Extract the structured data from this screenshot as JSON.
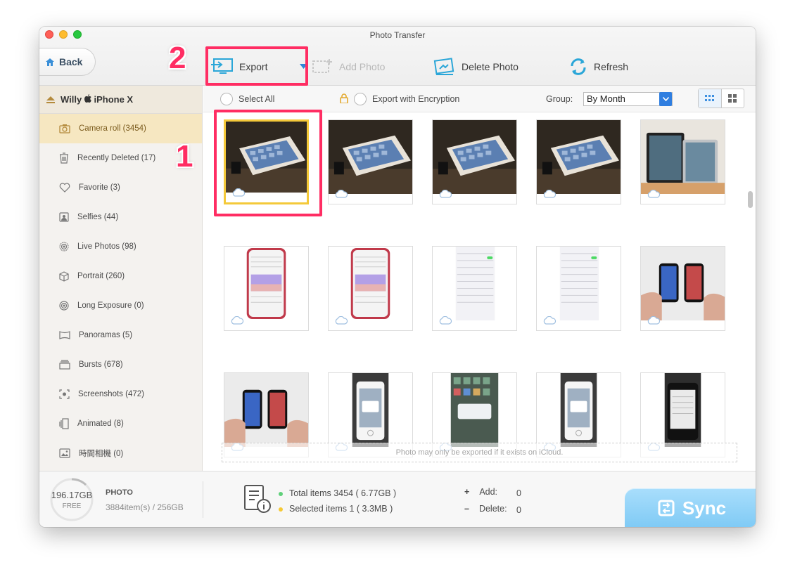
{
  "window": {
    "title": "Photo Transfer"
  },
  "toolbar": {
    "back_label": "Back",
    "export_label": "Export",
    "add_photo_label": "Add Photo",
    "delete_photo_label": "Delete Photo",
    "refresh_label": "Refresh"
  },
  "annotations": {
    "step1": "1",
    "step2": "2",
    "highlight_color": "#ff2d63"
  },
  "sidebar": {
    "device_name": "Willy  iPhone X",
    "device_user": "Willy",
    "device_model": "iPhone X",
    "items": [
      {
        "label": "Camera roll (3454)",
        "icon": "camera-icon",
        "active": true
      },
      {
        "label": "Recently Deleted (17)",
        "icon": "trash-icon",
        "active": false
      },
      {
        "label": "Favorite (3)",
        "icon": "heart-icon",
        "active": false
      },
      {
        "label": "Selfies (44)",
        "icon": "portrait-icon",
        "active": false
      },
      {
        "label": "Live Photos (98)",
        "icon": "live-photo-icon",
        "active": false
      },
      {
        "label": "Portrait (260)",
        "icon": "cube-icon",
        "active": false
      },
      {
        "label": "Long Exposure (0)",
        "icon": "long-exposure-icon",
        "active": false
      },
      {
        "label": "Panoramas (5)",
        "icon": "panorama-icon",
        "active": false
      },
      {
        "label": "Bursts (678)",
        "icon": "bursts-icon",
        "active": false
      },
      {
        "label": "Screenshots (472)",
        "icon": "screenshot-icon",
        "active": false
      },
      {
        "label": "Animated (8)",
        "icon": "animated-icon",
        "active": false
      },
      {
        "label": "時間相機 (0)",
        "icon": "image-icon",
        "active": false
      }
    ]
  },
  "content": {
    "select_all_label": "Select All",
    "export_encryption_label": "Export with Encryption",
    "group_label": "Group:",
    "group_value": "By Month",
    "notice": "Photo may only be exported if it exists on iCloud."
  },
  "photos": [
    {
      "kind": "ipad",
      "selected": true
    },
    {
      "kind": "ipad",
      "selected": false
    },
    {
      "kind": "ipad",
      "selected": false
    },
    {
      "kind": "ipad",
      "selected": false
    },
    {
      "kind": "tablets",
      "selected": false
    },
    {
      "kind": "phone-screen",
      "selected": false
    },
    {
      "kind": "phone-screen",
      "selected": false
    },
    {
      "kind": "screenshot",
      "selected": false
    },
    {
      "kind": "screenshot",
      "selected": false
    },
    {
      "kind": "hands-phones",
      "selected": false
    },
    {
      "kind": "hands-phones",
      "selected": false
    },
    {
      "kind": "iphone-white",
      "selected": false
    },
    {
      "kind": "iphone-screen",
      "selected": false
    },
    {
      "kind": "iphone-white",
      "selected": false
    },
    {
      "kind": "iphone-dark",
      "selected": false
    }
  ],
  "footer": {
    "storage_free": "196.17GB",
    "storage_free_label": "FREE",
    "category": "PHOTO",
    "category_detail": "3884item(s) / 256GB",
    "total_items": "Total items 3454 ( 6.77GB )",
    "selected_items": "Selected items 1 ( 3.3MB )",
    "add_label": "Add:",
    "add_value": "0",
    "delete_label": "Delete:",
    "delete_value": "0",
    "sync_label": "Sync"
  },
  "colors": {
    "accent": "#2f7ee0",
    "sync": "#8fd1f7",
    "active_item": "#f6e7c1"
  }
}
